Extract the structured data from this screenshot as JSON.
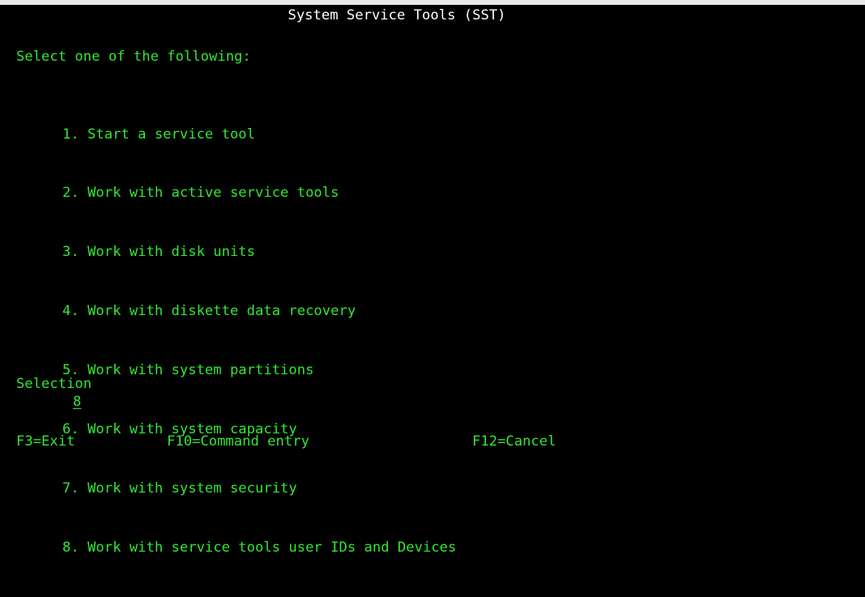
{
  "header": {
    "title": "System Service Tools (SST)"
  },
  "instruction": "Select one of the following:",
  "menu": {
    "items": [
      "1. Start a service tool",
      "2. Work with active service tools",
      "3. Work with disk units",
      "4. Work with diskette data recovery",
      "5. Work with system partitions",
      "6. Work with system capacity",
      "7. Work with system security",
      "8. Work with service tools user IDs and Devices"
    ]
  },
  "selection": {
    "label": "Selection",
    "value": "8"
  },
  "function_keys": {
    "exit": "F3=Exit",
    "command_entry": "F10=Command entry",
    "cancel": "F12=Cancel"
  },
  "colors": {
    "background": "#000000",
    "text_green": "#33e633",
    "text_white": "#ffffff"
  }
}
